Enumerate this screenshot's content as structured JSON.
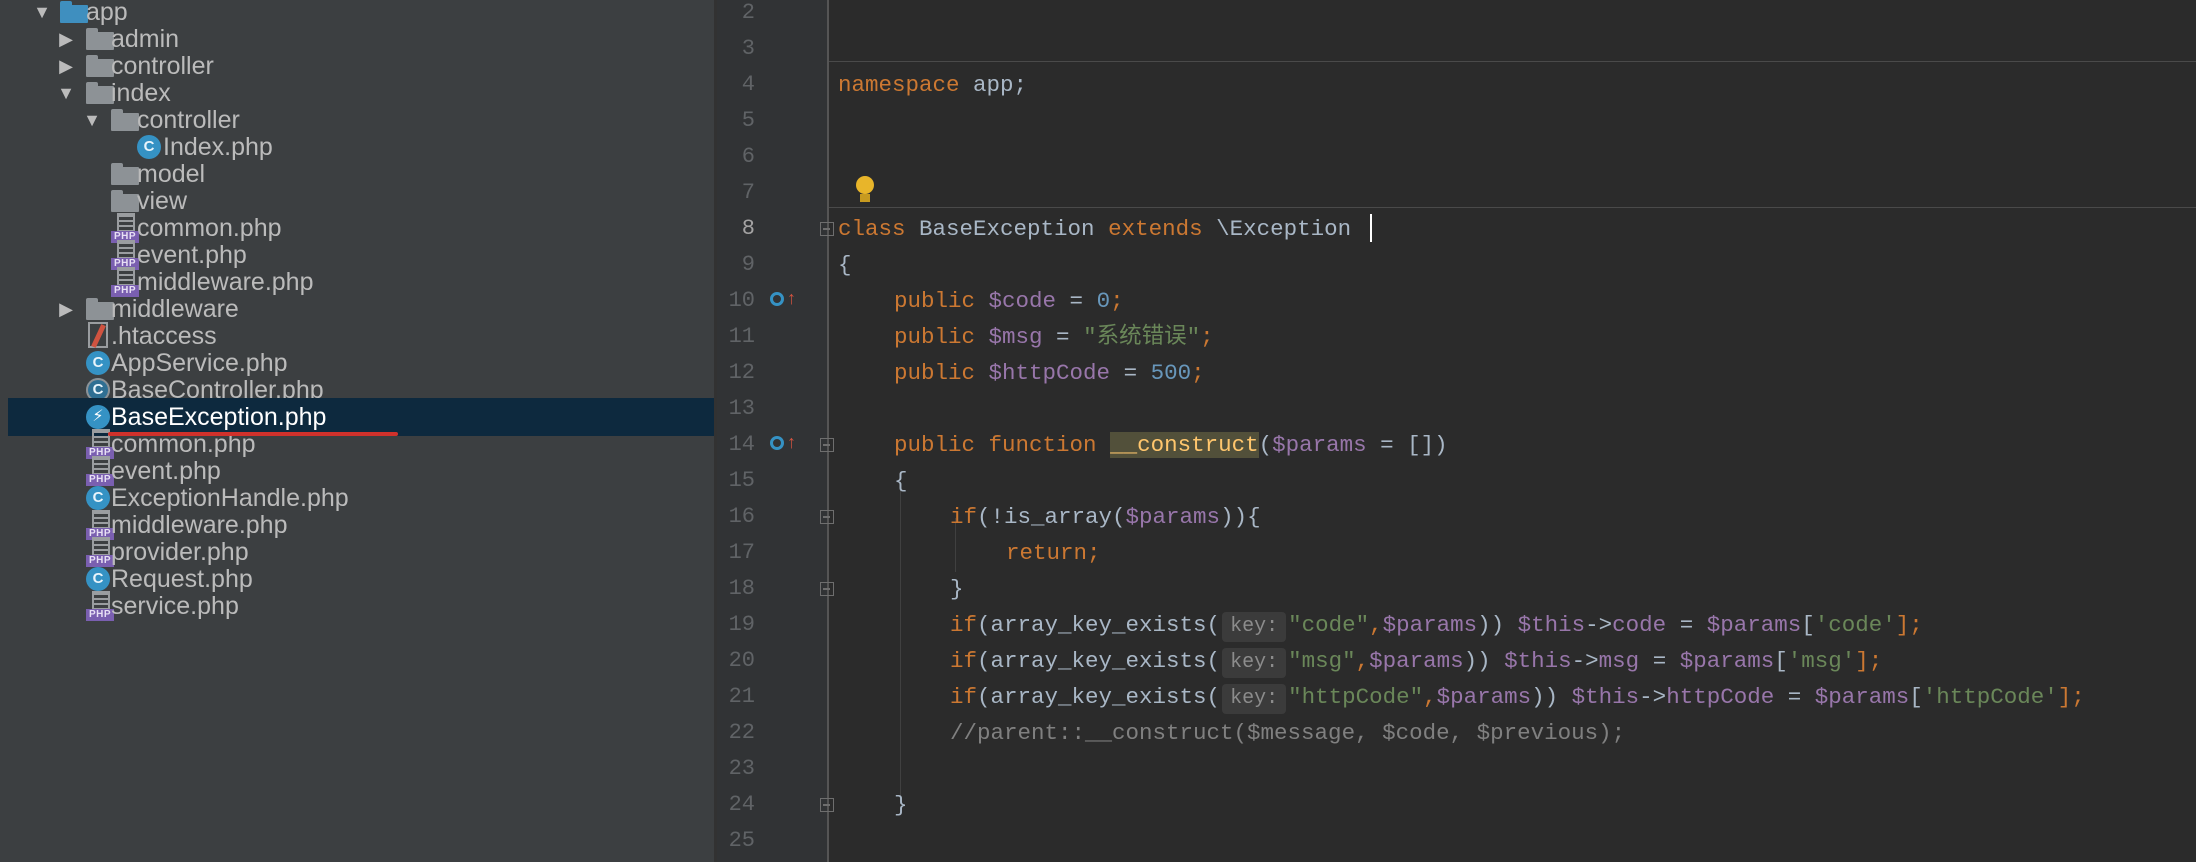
{
  "project_tree": {
    "items": [
      {
        "label": "app",
        "icon": "folder-icon",
        "expanded": true
      },
      {
        "label": "admin",
        "icon": "folder-icon",
        "expanded": false
      },
      {
        "label": "controller",
        "icon": "folder-icon",
        "expanded": false
      },
      {
        "label": "index",
        "icon": "folder-icon",
        "expanded": true
      },
      {
        "label": "controller",
        "icon": "folder-icon",
        "expanded": true
      },
      {
        "label": "Index.php",
        "icon": "php-class-icon"
      },
      {
        "label": "model",
        "icon": "folder-icon"
      },
      {
        "label": "view",
        "icon": "folder-icon"
      },
      {
        "label": "common.php",
        "icon": "php-file-icon"
      },
      {
        "label": "event.php",
        "icon": "php-file-icon"
      },
      {
        "label": "middleware.php",
        "icon": "php-file-icon"
      },
      {
        "label": "middleware",
        "icon": "folder-icon",
        "expanded": false
      },
      {
        "label": ".htaccess",
        "icon": "htaccess-icon"
      },
      {
        "label": "AppService.php",
        "icon": "php-class-icon"
      },
      {
        "label": "BaseController.php",
        "icon": "php-abstract-class-icon"
      },
      {
        "label": "BaseException.php",
        "icon": "php-exception-class-icon",
        "selected": true
      },
      {
        "label": "common.php",
        "icon": "php-file-icon"
      },
      {
        "label": "event.php",
        "icon": "php-file-icon"
      },
      {
        "label": "ExceptionHandle.php",
        "icon": "php-class-icon"
      },
      {
        "label": "middleware.php",
        "icon": "php-file-icon"
      },
      {
        "label": "provider.php",
        "icon": "php-file-icon"
      },
      {
        "label": "Request.php",
        "icon": "php-class-icon"
      },
      {
        "label": "service.php",
        "icon": "php-file-icon"
      }
    ],
    "php_badge": "PHP",
    "class_badge": "C",
    "exception_badge": "⚡"
  },
  "editor": {
    "line_numbers": [
      "2",
      "3",
      "4",
      "5",
      "6",
      "7",
      "8",
      "9",
      "10",
      "11",
      "12",
      "13",
      "14",
      "15",
      "16",
      "17",
      "18",
      "19",
      "20",
      "21",
      "22",
      "23",
      "24",
      "25"
    ],
    "current_line": "8",
    "code": {
      "namespace_kw": "namespace",
      "namespace_name": " app;",
      "class_kw": "class",
      "class_name": " BaseException ",
      "extends_kw": "extends",
      "parent_class": " \\Exception",
      "open_brace": "{",
      "public_kw": "public",
      "var_code": "$code",
      "assign": " = ",
      "val_code": "0",
      "semicolon": ";",
      "var_msg": "$msg",
      "val_msg": "\"系统错误\"",
      "var_httpcode": "$httpCode",
      "val_httpcode": "500",
      "function_kw": "function",
      "construct_name": "__construct",
      "paren_open": "(",
      "var_params": "$params",
      "params_default": " = [])",
      "if_kw": "if",
      "is_array_call": "(!is_array(",
      "is_array_close": ")){",
      "return_kw": "return",
      "close_brace": "}",
      "ake_call": "(array_key_exists(",
      "key_hint": "key:",
      "str_code": "\"code\"",
      "comma": ",",
      "close_paren2": ")) ",
      "this_var": "$this",
      "arrow": "->",
      "prop_code": "code",
      "bracket_open": "[",
      "sq_code": "'code'",
      "bracket_close": "];",
      "str_msg": "\"msg\"",
      "prop_msg": "msg",
      "sq_msg": "'msg'",
      "str_httpcode": "\"httpCode\"",
      "prop_httpcode": "httpCode",
      "sq_httpcode": "'httpCode'",
      "comment_line": "//parent::__construct($message, $code, $previous);"
    }
  },
  "colors": {
    "tree_bg": "#3c3f41",
    "selection": "#0d293e",
    "editor_bg": "#2b2b2b",
    "keyword": "#cc7832",
    "variable": "#9876aa",
    "number": "#6897bb",
    "string": "#6a8759",
    "underline_annotation": "#d0312b"
  }
}
